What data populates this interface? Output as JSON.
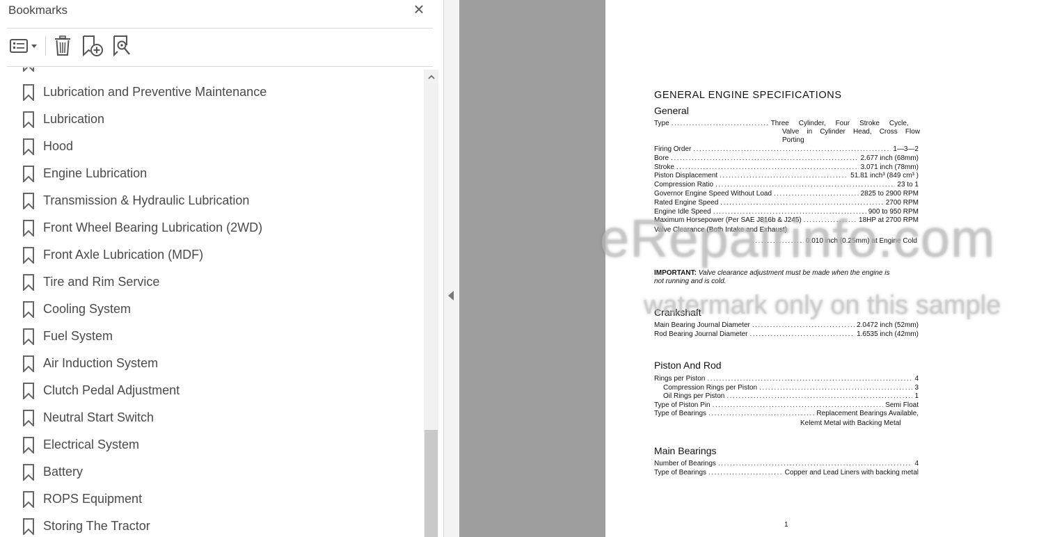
{
  "panel": {
    "title": "Bookmarks",
    "close_icon": "×",
    "toolbar": {
      "options_icon": "list-options-icon",
      "delete_icon": "trash-icon",
      "add_icon": "add-bookmark-icon",
      "search_icon": "find-bookmark-icon"
    },
    "items": [
      {
        "label": "Lubrication and Preventive Maintenance"
      },
      {
        "label": "Lubrication"
      },
      {
        "label": "Hood"
      },
      {
        "label": "Engine Lubrication"
      },
      {
        "label": "Transmission & Hydraulic Lubrication"
      },
      {
        "label": "Front Wheel Bearing Lubrication (2WD)"
      },
      {
        "label": "Front Axle Lubrication (MDF)"
      },
      {
        "label": "Tire and Rim Service"
      },
      {
        "label": "Cooling System"
      },
      {
        "label": "Fuel System"
      },
      {
        "label": "Air Induction System"
      },
      {
        "label": "Clutch Pedal Adjustment"
      },
      {
        "label": "Neutral Start Switch"
      },
      {
        "label": "Electrical System"
      },
      {
        "label": "Battery"
      },
      {
        "label": "ROPS Equipment"
      },
      {
        "label": "Storing The Tractor"
      }
    ]
  },
  "doc": {
    "title": "GENERAL ENGINE SPECIFICATIONS",
    "general": {
      "heading": "General",
      "type_label": "Type",
      "type_value_1": "Three Cylinder, Four Stroke Cycle,",
      "type_value_2": "Valve in Cylinder Head, Cross Flow",
      "type_value_3": "Porting",
      "rows": [
        {
          "label": "Firing Order",
          "value": "1—3—2"
        },
        {
          "label": "Bore",
          "value": "2.677 inch (68mm)"
        },
        {
          "label": "Stroke",
          "value": "3.071 inch (78mm)"
        },
        {
          "label": "Piston Displacement",
          "value": "51.81 inch³ (849 cm³ )"
        },
        {
          "label": "Compression Ratio",
          "value": "23 to 1"
        },
        {
          "label": "Governor Engine Speed Without Load",
          "value": "2825 to 2900 RPM"
        },
        {
          "label": "Rated Engine Speed",
          "value": "2700 RPM"
        },
        {
          "label": "Engine Idle Speed",
          "value": "900 to 950 RPM"
        },
        {
          "label": "Maximum Horsepower (Per SAE J816b & J245)",
          "value": "18HP at 2700 RPM"
        }
      ],
      "valve_label": "Valve Clearance (Both Intake and Exhaust)",
      "valve_value": "0.010 inch (0.25mm) at Engine Cold"
    },
    "important_label": "IMPORTANT:",
    "important_text_1": "Valve clearance adjustment must be made when the engine is",
    "important_text_2": "not running and is cold.",
    "crankshaft": {
      "heading": "Crankshaft",
      "rows": [
        {
          "label": "Main Bearing Journal Diameter",
          "value": "2.0472 inch (52mm)"
        },
        {
          "label": "Rod Bearing Journal Diameter",
          "value": "1.6535 inch (42mm)"
        }
      ]
    },
    "piston": {
      "heading": "Piston And Rod",
      "rows": [
        {
          "label": "Rings per Piston",
          "value": "4"
        },
        {
          "label": "Compression Rings per Piston",
          "value": "3"
        },
        {
          "label": "Oil Rings per Piston",
          "value": "1"
        },
        {
          "label": "Type of Piston Pin",
          "value": "Semi Float"
        },
        {
          "label": "Type of Bearings",
          "value": "Replacement Bearings Available,"
        }
      ],
      "bearing_value_2": "Kelemt Metal with Backing Metal"
    },
    "main_bearings": {
      "heading": "Main Bearings",
      "rows": [
        {
          "label": "Number of Bearings",
          "value": "4"
        },
        {
          "label": "Type of Bearings",
          "value": "Copper and Lead Liners with backing metal"
        }
      ]
    },
    "page_number": "1"
  },
  "watermark": {
    "line1": "eRepairinfo.com",
    "line2": "watermark only on this sample"
  }
}
